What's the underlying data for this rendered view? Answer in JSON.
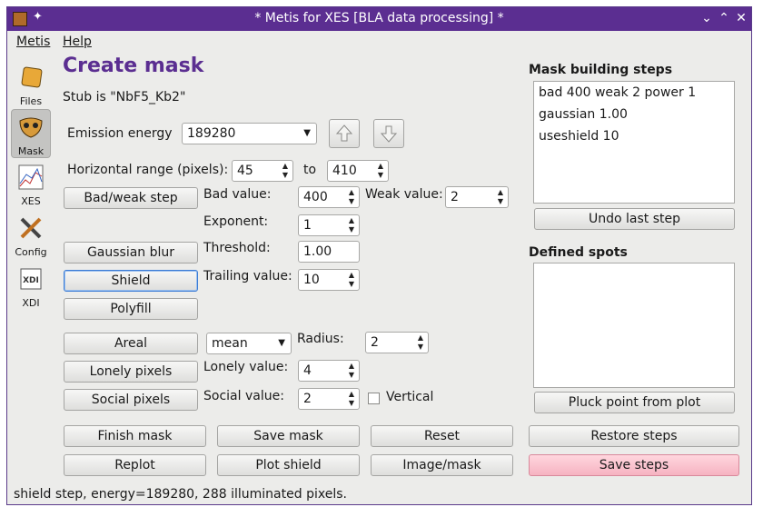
{
  "window": {
    "title": "* Metis for XES [BLA data processing] *",
    "minimize_icon": "chevron-down-icon",
    "maximize_icon": "chevron-up-icon",
    "close_icon": "close-icon"
  },
  "menu": {
    "metis": "Metis",
    "help": "Help"
  },
  "sidebar": [
    {
      "label": "Files",
      "icon": "files-icon"
    },
    {
      "label": "Mask",
      "icon": "mask-icon"
    },
    {
      "label": "XES",
      "icon": "xes-plot-icon"
    },
    {
      "label": "Config",
      "icon": "config-tools-icon"
    },
    {
      "label": "XDI",
      "icon": "xdi-icon"
    }
  ],
  "main": {
    "title": "Create mask",
    "stub": "Stub is \"NbF5_Kb2\"",
    "emission_label": "Emission energy",
    "emission_value": "189280",
    "hrange_label": "Horizontal range (pixels):",
    "hrange_from": "45",
    "hrange_to_label": "to",
    "hrange_to": "410",
    "badweak_button": "Bad/weak step",
    "bad_value_label": "Bad value:",
    "bad_value": "400",
    "weak_value_label": "Weak value:",
    "weak_value": "2",
    "exponent_label": "Exponent:",
    "exponent": "1",
    "gaussian_button": "Gaussian blur",
    "threshold_label": "Threshold:",
    "threshold": "1.00",
    "shield_button": "Shield",
    "trailing_label": "Trailing value:",
    "trailing": "10",
    "polyfill_button": "Polyfill",
    "areal_button": "Areal",
    "areal_mode": "mean",
    "radius_label": "Radius:",
    "radius": "2",
    "lonely_button": "Lonely pixels",
    "lonely_label": "Lonely value:",
    "lonely_value": "4",
    "social_button": "Social pixels",
    "social_label": "Social value:",
    "social_value": "2",
    "vertical_label": "Vertical",
    "finish_button": "Finish mask",
    "savemask_button": "Save mask",
    "reset_button": "Reset",
    "replot_button": "Replot",
    "plotshield_button": "Plot shield",
    "imagemask_button": "Image/mask"
  },
  "right": {
    "steps_title": "Mask building steps",
    "steps": [
      "bad 400 weak 2 power 1",
      "gaussian 1.00",
      "useshield 10"
    ],
    "undo_button": "Undo last step",
    "spots_title": "Defined spots",
    "pluck_button": "Pluck point from plot",
    "restore_button": "Restore steps",
    "save_steps_button": "Save steps"
  },
  "status": "shield step, energy=189280, 288 illuminated pixels."
}
